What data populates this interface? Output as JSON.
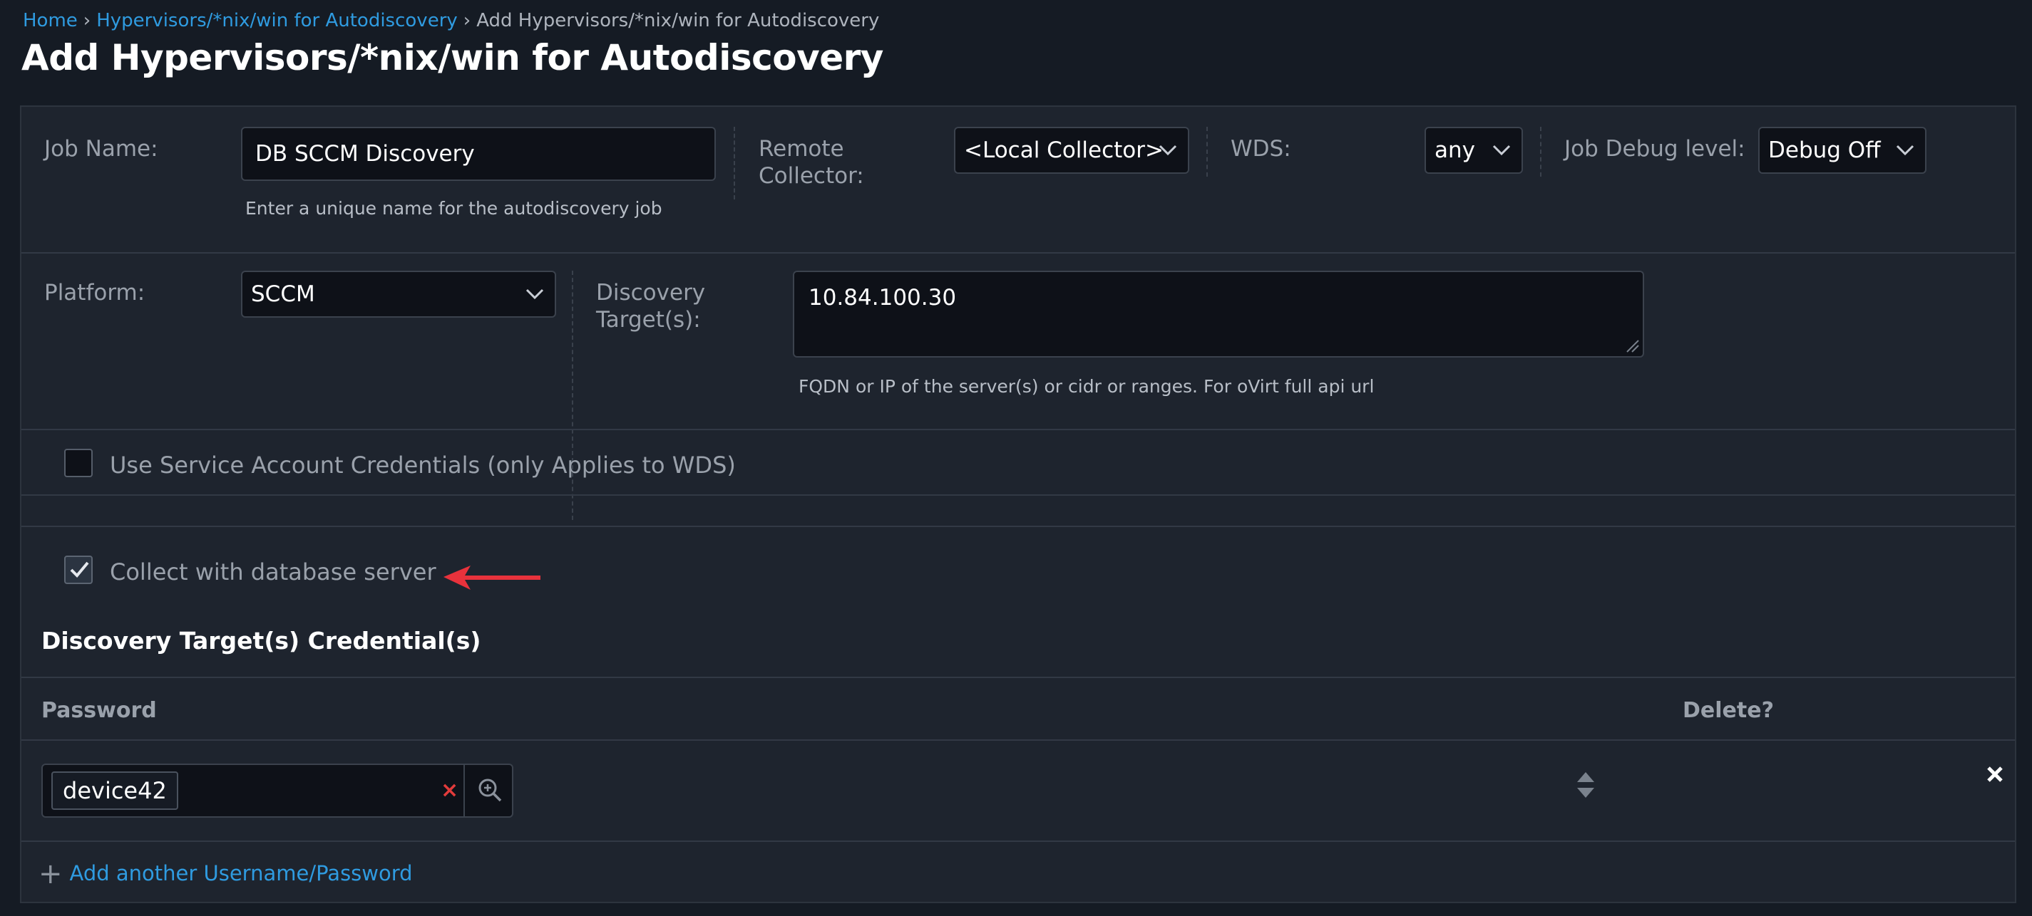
{
  "breadcrumb": {
    "home": "Home",
    "parent": "Hypervisors/*nix/win for Autodiscovery",
    "current": "Add Hypervisors/*nix/win for Autodiscovery",
    "separator": "›"
  },
  "page_title": "Add Hypervisors/*nix/win for Autodiscovery",
  "form": {
    "job_name": {
      "label": "Job Name:",
      "value": "DB SCCM Discovery",
      "help": "Enter a unique name for the autodiscovery job"
    },
    "remote_collector": {
      "label_line1": "Remote",
      "label_line2": "Collector:",
      "value": "<Local Collector>"
    },
    "wds": {
      "label": "WDS:",
      "value": "any"
    },
    "job_debug_level": {
      "label": "Job Debug level:",
      "value": "Debug Off"
    },
    "platform": {
      "label": "Platform:",
      "value": "SCCM"
    },
    "discovery_targets": {
      "label_line1": "Discovery",
      "label_line2": "Target(s):",
      "value": "10.84.100.30",
      "help": "FQDN or IP of the server(s) or cidr or ranges. For oVirt full api url"
    },
    "use_service_account": {
      "label": "Use Service Account Credentials (only Applies to WDS)",
      "checked": false
    },
    "collect_with_db": {
      "label": "Collect with database server",
      "checked": true
    }
  },
  "credentials": {
    "section_title": "Discovery Target(s) Credential(s)",
    "columns": {
      "password": "Password",
      "delete": "Delete?"
    },
    "rows": [
      {
        "password_tag": "device42",
        "clear_glyph": "×"
      }
    ],
    "add_link": "Add another Username/Password",
    "add_plus": "+"
  },
  "icons": {
    "select": "chevron-down-icon",
    "search": "zoom-in-icon",
    "sort": "sort-icon",
    "delete": "close-icon",
    "check": "check-icon"
  },
  "colors": {
    "background": "#151b24",
    "panel": "#1e242e",
    "link": "#2f9be0",
    "annotation_arrow": "#e8323c",
    "clear_x": "#e23b3b"
  }
}
